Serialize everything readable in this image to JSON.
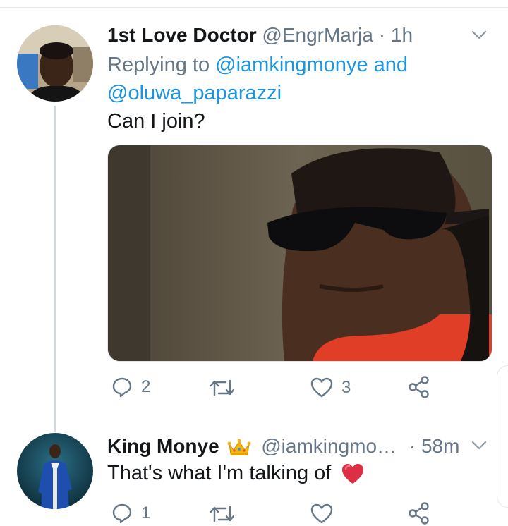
{
  "tweet1": {
    "name": "1st Love Doctor",
    "handle": "@EngrMarja",
    "separator": "·",
    "time": "1h",
    "replying_prefix": "Replying to",
    "mention1": "@iamkingmonye",
    "and": "and",
    "mention2": "@oluwa_paparazzi",
    "text": "Can I join?",
    "reply_count": "2",
    "retweet_count": "",
    "like_count": "3"
  },
  "tweet2": {
    "name": "King Monye",
    "handle": "@iamkingmo…",
    "separator": "·",
    "time": "58m",
    "text": "That's what I'm talking of",
    "reply_count": "1",
    "retweet_count": "",
    "like_count": ""
  },
  "icons": {
    "reply": "reply-icon",
    "retweet": "retweet-icon",
    "like": "heart-icon",
    "share": "share-icon",
    "more": "chevron-down-icon",
    "badge": "crown-emoji",
    "emoji": "red-heart-emoji"
  },
  "colors": {
    "link": "#1b95e0",
    "muted": "#657786",
    "text": "#14171a",
    "thread_line": "#cfd9de"
  }
}
